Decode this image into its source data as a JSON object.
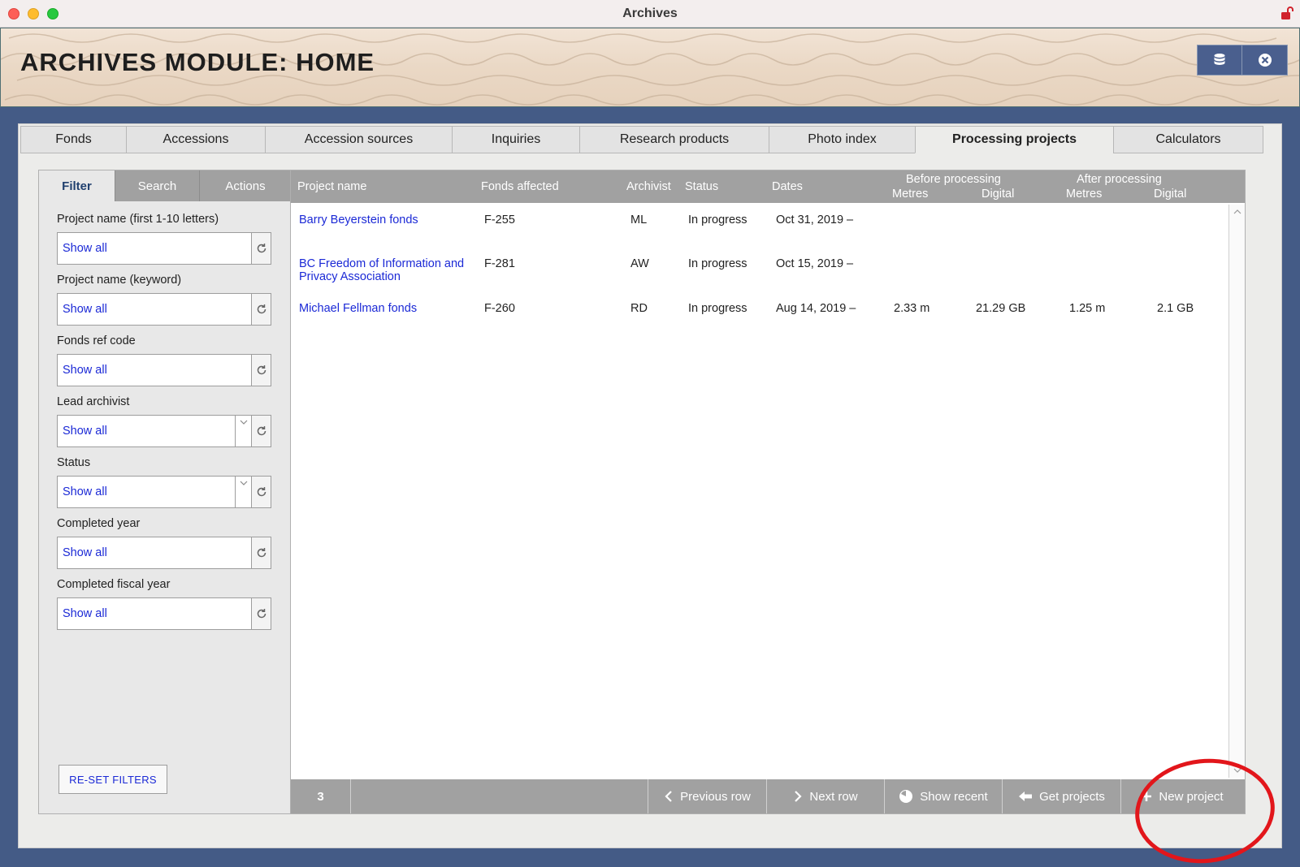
{
  "window": {
    "title": "Archives"
  },
  "header": {
    "title": "ARCHIVES MODULE: HOME",
    "buttons": [
      "database-icon",
      "close-circle-icon"
    ]
  },
  "main_tabs": [
    {
      "label": "Fonds"
    },
    {
      "label": "Accessions"
    },
    {
      "label": "Accession sources"
    },
    {
      "label": "Inquiries"
    },
    {
      "label": "Research products"
    },
    {
      "label": "Photo index"
    },
    {
      "label": "Processing projects",
      "active": true
    },
    {
      "label": "Calculators"
    }
  ],
  "sidebar": {
    "tabs": [
      {
        "label": "Filter",
        "active": true
      },
      {
        "label": "Search"
      },
      {
        "label": "Actions"
      }
    ],
    "filters": [
      {
        "label": "Project name (first 1-10 letters)",
        "value": "Show all",
        "dropdown": false
      },
      {
        "label": "Project name (keyword)",
        "value": "Show all",
        "dropdown": false
      },
      {
        "label": "Fonds ref code",
        "value": "Show all",
        "dropdown": false
      },
      {
        "label": "Lead archivist",
        "value": "Show all",
        "dropdown": true
      },
      {
        "label": "Status",
        "value": "Show all",
        "dropdown": true
      },
      {
        "label": "Completed year",
        "value": "Show all",
        "dropdown": false
      },
      {
        "label": "Completed fiscal year",
        "value": "Show all",
        "dropdown": false
      }
    ],
    "reset_label": "RE-SET FILTERS"
  },
  "table": {
    "headers": {
      "project_name": "Project name",
      "fonds_affected": "Fonds affected",
      "archivist": "Archivist",
      "status": "Status",
      "dates": "Dates",
      "before_processing": "Before processing",
      "after_processing": "After processing",
      "metres": "Metres",
      "digital": "Digital"
    },
    "rows": [
      {
        "project_name": "Barry Beyerstein fonds",
        "fonds": "F-255",
        "archivist": "ML",
        "status": "In progress",
        "dates": "Oct 31, 2019 –",
        "before_metres": "",
        "before_digital": "",
        "after_metres": "",
        "after_digital": ""
      },
      {
        "project_name": "BC Freedom of Information and Privacy Association",
        "fonds": "F-281",
        "archivist": "AW",
        "status": "In progress",
        "dates": "Oct 15, 2019 –",
        "before_metres": "",
        "before_digital": "",
        "after_metres": "",
        "after_digital": ""
      },
      {
        "project_name": "Michael Fellman fonds",
        "fonds": "F-260",
        "archivist": "RD",
        "status": "In progress",
        "dates": "Aug 14, 2019 –",
        "before_metres": "2.33 m",
        "before_digital": "21.29 GB",
        "after_metres": "1.25 m",
        "after_digital": "2.1 GB"
      }
    ]
  },
  "bottom_bar": {
    "count": "3",
    "buttons": [
      {
        "label": "Previous row",
        "icon": "chevron-left-icon"
      },
      {
        "label": "Next row",
        "icon": "chevron-right-icon"
      },
      {
        "label": "Show recent",
        "icon": "pie-clock-icon"
      },
      {
        "label": "Get projects",
        "icon": "arrow-left-icon"
      },
      {
        "label": "New project",
        "icon": "plus-icon"
      }
    ]
  },
  "colors": {
    "frame": "#445b86",
    "link": "#1b29d6",
    "header_gray": "#a1a1a1",
    "annotation": "#e2161b"
  }
}
